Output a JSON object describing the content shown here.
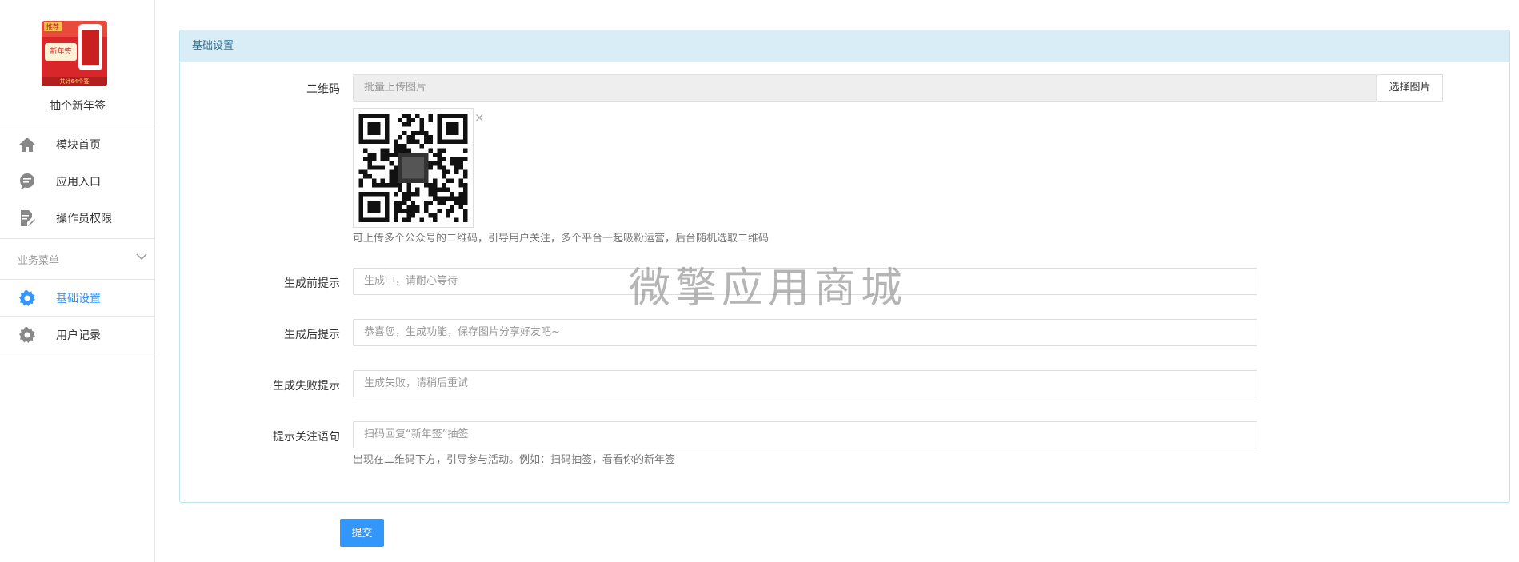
{
  "sidebar": {
    "app_name": "抽个新年签",
    "logo": {
      "badge": "推荐",
      "title": "新年签",
      "footer": "共计64个签"
    },
    "nav_items": [
      {
        "label": "模块首页",
        "icon": "home-icon"
      },
      {
        "label": "应用入口",
        "icon": "chat-bubble-icon"
      },
      {
        "label": "操作员权限",
        "icon": "edit-document-icon"
      }
    ],
    "menu_header": "业务菜单",
    "biz_items": [
      {
        "label": "基础设置",
        "icon": "gear-icon",
        "active": true
      },
      {
        "label": "用户记录",
        "icon": "gear-icon",
        "active": false
      }
    ]
  },
  "panel": {
    "title": "基础设置",
    "qrcode": {
      "label": "二维码",
      "placeholder": "批量上传图片",
      "choose_button": "选择图片",
      "close_symbol": "×",
      "help": "可上传多个公众号的二维码，引导用户关注，多个平台一起吸粉运营，后台随机选取二维码"
    },
    "before_tip": {
      "label": "生成前提示",
      "value": "生成中，请耐心等待"
    },
    "after_tip": {
      "label": "生成后提示",
      "value": "恭喜您，生成功能，保存图片分享好友吧~"
    },
    "fail_tip": {
      "label": "生成失败提示",
      "value": "生成失败，请稍后重试"
    },
    "follow_tip": {
      "label": "提示关注语句",
      "value": "扫码回复“新年签”抽签",
      "help": "出现在二维码下方，引导参与活动。例如：扫码抽签，看看你的新年签"
    }
  },
  "watermark": "微擎应用商城",
  "submit_label": "提交",
  "colors": {
    "accent": "#3296fa",
    "panel_header_bg": "#d9edf7",
    "panel_header_text": "#31708f"
  }
}
